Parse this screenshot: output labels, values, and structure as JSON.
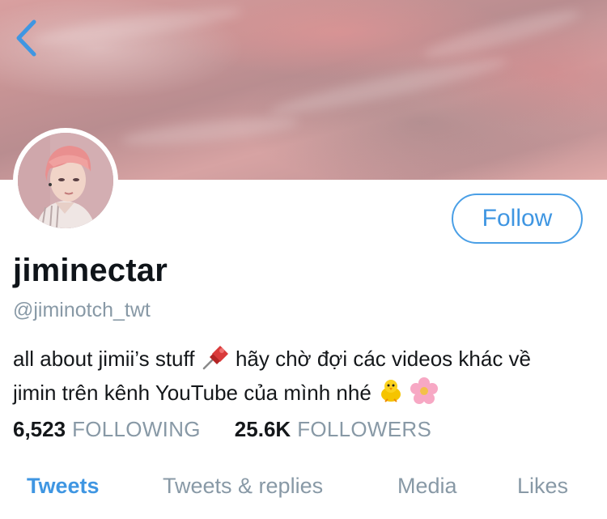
{
  "profile": {
    "display_name": "jiminectar",
    "handle": "@jiminotch_twt",
    "bio_line1": "all about jimii’s stuff",
    "bio_line1_rest": "hãy chờ đợi các videos khác về",
    "bio_line2": "jimin trên kênh YouTube của mình nhé",
    "follow_label": "Follow"
  },
  "stats": {
    "following_count": "6,523",
    "following_label": "FOLLOWING",
    "followers_count": "25.6K",
    "followers_label": "FOLLOWERS"
  },
  "tabs": [
    {
      "label": "Tweets",
      "active": true
    },
    {
      "label": "Tweets & replies",
      "active": false
    },
    {
      "label": "Media",
      "active": false
    },
    {
      "label": "Likes",
      "active": false
    }
  ],
  "icons": {
    "back": "chevron-left-icon",
    "pin": "pushpin-icon",
    "chick": "chick-icon",
    "flower": "cherry-blossom-icon"
  },
  "colors": {
    "accent": "#3f96e2",
    "muted": "#8899a6",
    "text": "#14171a"
  }
}
